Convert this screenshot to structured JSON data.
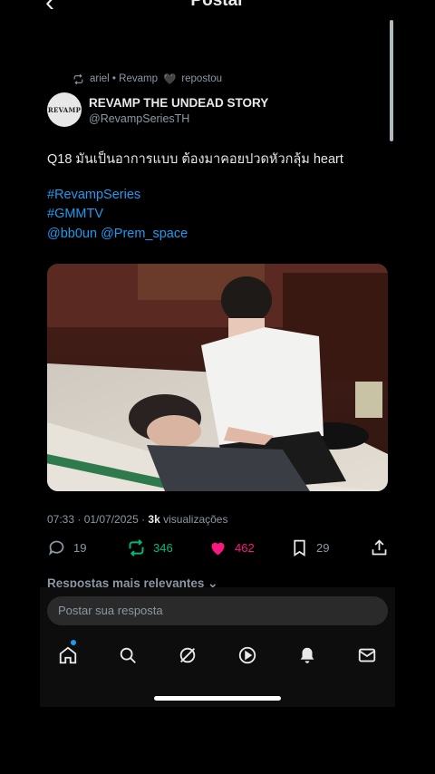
{
  "header": {
    "title": "Postar"
  },
  "repost": {
    "text": "ariel • Revamp",
    "suffix": "repostou"
  },
  "author": {
    "name": "REVAMP THE UNDEAD STORY",
    "handle": "@RevampSeriesTH",
    "avatar_text": "REVAMP"
  },
  "tweet": {
    "text": "Q18 มันเป็นอาการแบบ ต้องมาคอยปวดหัวกลุ้ม heart",
    "hashtags": [
      "#RevampSeries",
      "#GMMTV"
    ],
    "mentions": "@bb0un @Prem_space"
  },
  "meta": {
    "time_date": "07:33 · 01/07/2025 · ",
    "views_count": "3k",
    "views_label": " visualizações"
  },
  "actions": {
    "replies": "19",
    "reposts": "346",
    "likes": "462",
    "bookmarks": "29"
  },
  "colors": {
    "accent": "#1d9bf0",
    "repost_green": "#00ba7c",
    "like_pink": "#f91880"
  },
  "replies_section": {
    "label": "Respostas mais relevantes"
  },
  "reply_input": {
    "placeholder": "Postar sua resposta"
  },
  "nav": [
    "home-icon",
    "search-icon",
    "grok-icon",
    "video-icon",
    "notifications-icon",
    "messages-icon"
  ]
}
